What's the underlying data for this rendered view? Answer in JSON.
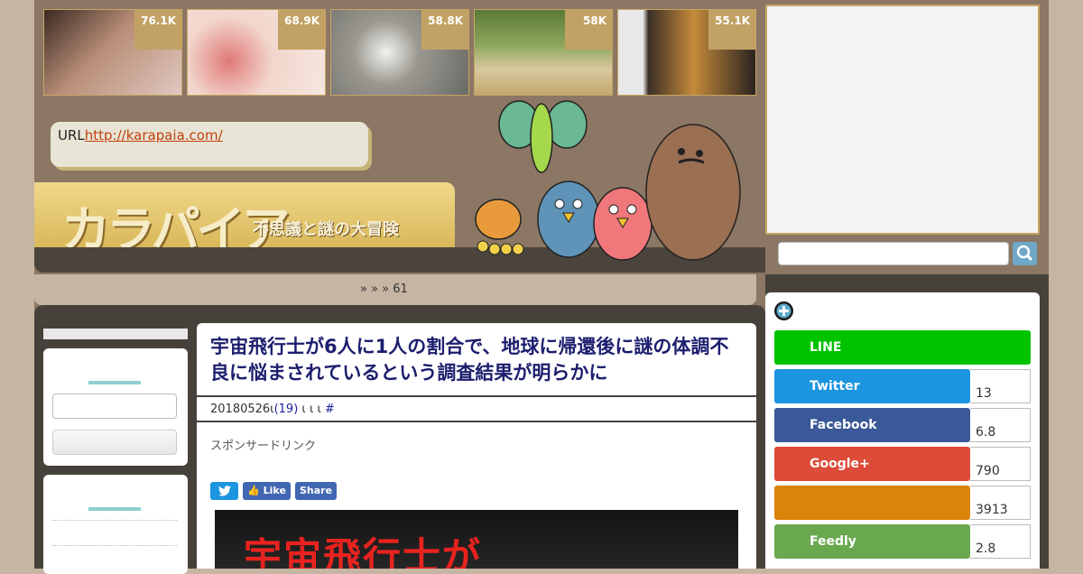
{
  "thumbnails": [
    {
      "count": "76.1K",
      "color": "#8a7b82"
    },
    {
      "count": "68.9K",
      "color": "#d8a4a0"
    },
    {
      "count": "58.8K",
      "color": "#8f8f8a"
    },
    {
      "count": "58K",
      "color": "#6f8a4e"
    },
    {
      "count": "55.1K",
      "color": "#5a4a3a"
    }
  ],
  "header": {
    "url_label": "URL",
    "url_link": "http://karapaia.com/",
    "logo_main": "カラパイア",
    "logo_sub": "不思議と謎の大冒険"
  },
  "breadcrumb": "»   »  » 61",
  "article": {
    "title": "宇宙飛行士が6人に1人の割合で、地球に帰還後に謎の体調不良に悩まされているという調査結果が明らかに",
    "date": "20180526",
    "sep1": "ι",
    "comments": "(19)",
    "sep2": "ι ι ι",
    "hash": "#",
    "sponsor": "スポンサードリンク",
    "tweet_icon": "twitter-icon",
    "like_label": "Like",
    "share_label": "Share",
    "hero_text": "宇宙飛行士が"
  },
  "share": {
    "rows": [
      {
        "label": "LINE",
        "count": "",
        "color": "#00c300"
      },
      {
        "label": "Twitter",
        "count": "13",
        "color": "#1b95e0"
      },
      {
        "label": "Facebook",
        "count": "6.8",
        "color": "#3b5998"
      },
      {
        "label": "Google+",
        "count": "790",
        "color": "#dd4b39"
      },
      {
        "label": "",
        "count": "3913",
        "color": "#d9840a"
      },
      {
        "label": "Feedly",
        "count": "2.8",
        "color": "#6aa84f"
      }
    ]
  }
}
